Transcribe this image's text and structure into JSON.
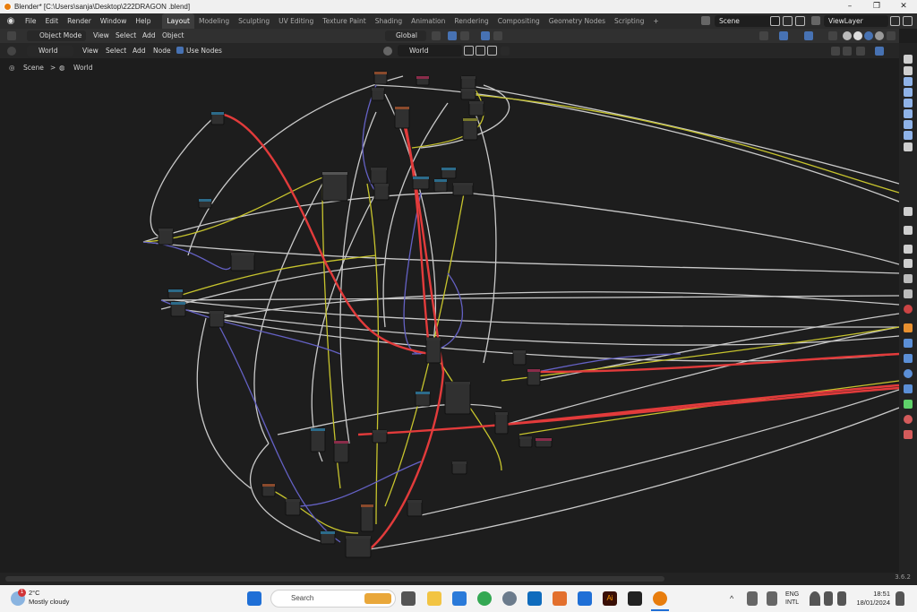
{
  "window": {
    "title": "Blender* [C:\\Users\\sanja\\Desktop\\222DRAGON .blend]",
    "min_label": "–",
    "restore_label": "❐",
    "close_label": "✕"
  },
  "topbar": {
    "menus": [
      "File",
      "Edit",
      "Render",
      "Window",
      "Help"
    ],
    "workspaces": [
      "Layout",
      "Modeling",
      "Sculpting",
      "UV Editing",
      "Texture Paint",
      "Shading",
      "Animation",
      "Rendering",
      "Compositing",
      "Geometry Nodes",
      "Scripting"
    ],
    "add_workspace": "+",
    "scene": "Scene",
    "view_layer": "ViewLayer"
  },
  "header": {
    "mode": "Object Mode",
    "menus": [
      "View",
      "Select",
      "Add",
      "Object"
    ],
    "transform_orientation": "Global"
  },
  "node_header": {
    "editor_type": "World",
    "menus": [
      "View",
      "Select",
      "Add",
      "Node"
    ],
    "use_nodes_label": "Use Nodes",
    "world_name": "World"
  },
  "breadcrumb": {
    "items": [
      "Scene",
      "World"
    ],
    "separator": ">"
  },
  "status": {
    "version": "3.6.2"
  },
  "taskbar": {
    "weather_badge": "1",
    "temperature": "2°C",
    "weather_desc": "Mostly cloudy",
    "search_placeholder": "Search",
    "lang_top": "ENG",
    "lang_bottom": "INTL",
    "time": "18:51",
    "date": "18/01/2024"
  },
  "colors": {
    "wire_white": "#c9c9c9",
    "wire_yellow": "#c7c42d",
    "wire_purple": "#6461c4",
    "wire_red": "#e23b3b",
    "accent_blue": "#4772b3"
  }
}
